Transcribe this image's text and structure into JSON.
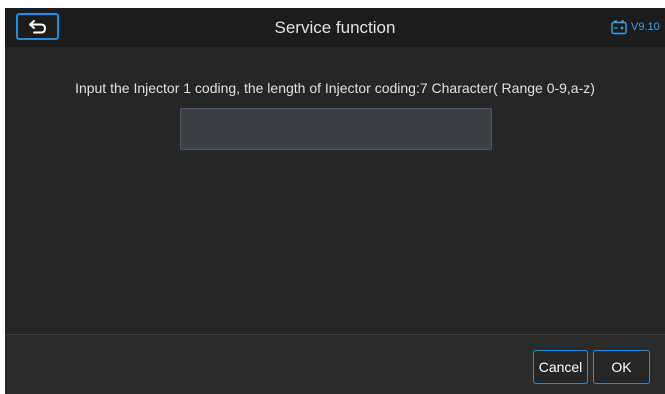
{
  "header": {
    "title": "Service function",
    "version": "V9.10",
    "back_icon": "back-arrow-icon",
    "battery_icon": "battery-icon"
  },
  "main": {
    "prompt": "Input the Injector 1 coding, the length of Injector coding:7 Character( Range 0-9,a-z)",
    "input_value": ""
  },
  "footer": {
    "cancel_label": "Cancel",
    "ok_label": "OK"
  },
  "colors": {
    "accent": "#1e8fe8",
    "background": "#262626",
    "header": "#1c1c1c",
    "input": "#3c3f44"
  }
}
